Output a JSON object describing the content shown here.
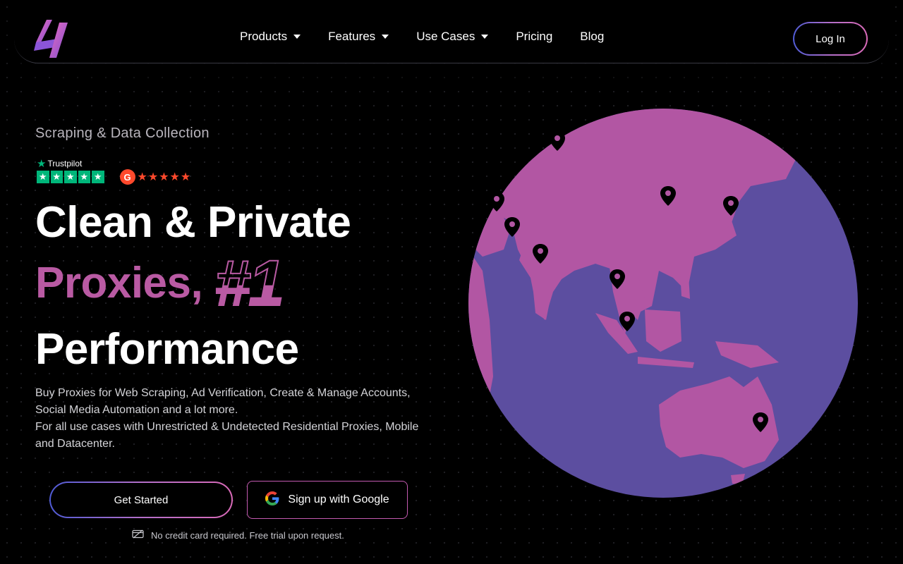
{
  "nav": {
    "menu": [
      {
        "label": "Products",
        "dropdown": true
      },
      {
        "label": "Features",
        "dropdown": true
      },
      {
        "label": "Use Cases",
        "dropdown": true
      },
      {
        "label": "Pricing",
        "dropdown": false
      },
      {
        "label": "Blog",
        "dropdown": false
      }
    ],
    "login_label": "Log In"
  },
  "hero": {
    "eyebrow": "Scraping & Data Collection",
    "trustpilot_label": "Trustpilot",
    "trustpilot_stars": 5,
    "g2_stars": 5,
    "headline_line1": "Clean & Private",
    "headline_line2": "Proxies,",
    "headline_badge": "#1",
    "headline_line3": "Performance",
    "description_line1": "Buy Proxies for Web Scraping, Ad Verification, Create & Manage Accounts, Social Media Automation and a lot more.",
    "description_line2": "For all use cases with Unrestricted & Undetected Residential Proxies, Mobile and Datacenter.",
    "cta_primary": "Get Started",
    "cta_google": "Sign up with Google",
    "note": "No credit card required. Free trial upon request."
  },
  "colors": {
    "accent_pink": "#b95aa3",
    "globe_ocean": "#5c4ea0",
    "globe_land": "#b256a3",
    "trustpilot_green": "#00b67a",
    "g2_red": "#ff492c"
  },
  "icons": [
    "logo-icon",
    "chevron-down-icon",
    "trustpilot-star-icon",
    "g2-icon",
    "google-icon",
    "no-card-icon",
    "map-pin-icon"
  ]
}
